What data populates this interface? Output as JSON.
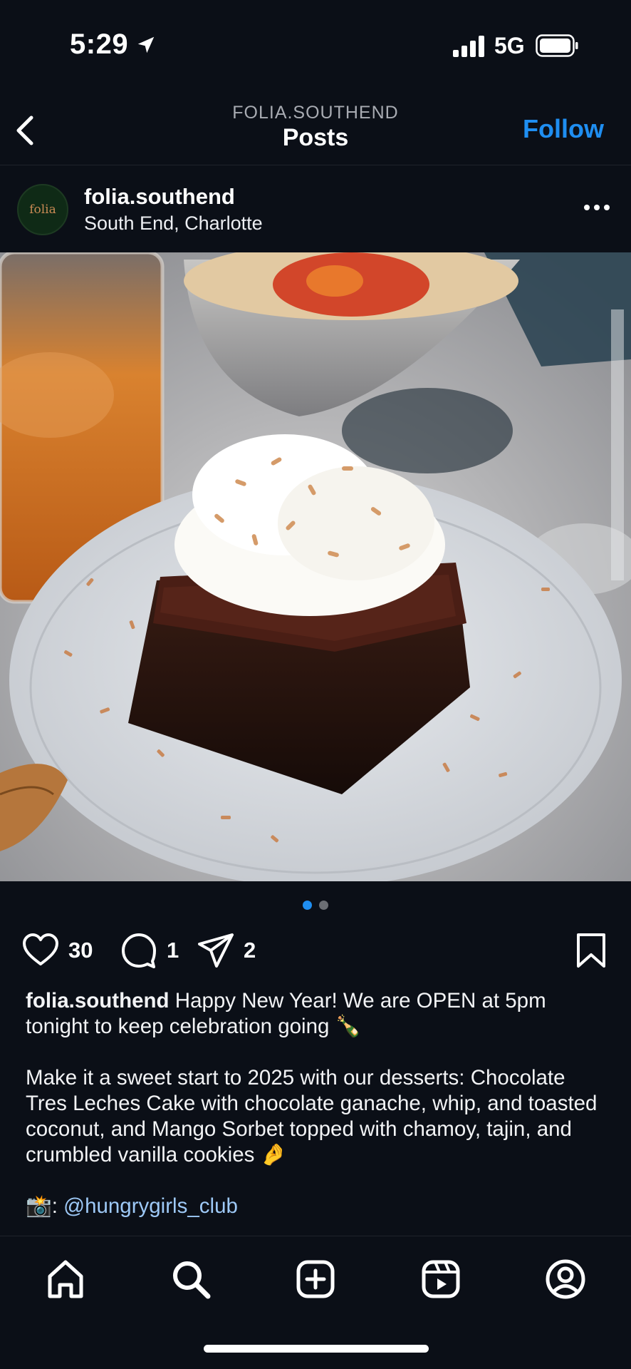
{
  "status_bar": {
    "time": "5:29",
    "network": "5G"
  },
  "header": {
    "account_caption": "FOLIA.SOUTHEND",
    "title": "Posts",
    "follow_label": "Follow"
  },
  "post": {
    "avatar_text": "folia",
    "username": "folia.southend",
    "location": "South End, Charlotte",
    "image_icon": "food-photo",
    "carousel": {
      "current": 1,
      "total": 2
    },
    "likes": "30",
    "comments": "1",
    "shares": "2",
    "caption": {
      "username": "folia.southend",
      "line1": "Happy New Year! We are OPEN at 5pm tonight to keep celebration going 🍾",
      "line2": "Make it a sweet start to 2025 with our desserts: Chocolate Tres Leches Cake with chocolate ganache, whip, and toasted coconut, and Mango Sorbet topped with chamoy, tajin, and crumbled vanilla cookies 🤌",
      "credit_prefix": "📸: ",
      "credit_handle": "@hungrygirls_club"
    }
  },
  "tab_bar": {
    "items": [
      "home-icon",
      "search-icon",
      "create-icon",
      "reels-icon",
      "profile-icon"
    ],
    "active": "search-icon"
  },
  "colors": {
    "background": "#0b0f17",
    "accent": "#1f8ef1",
    "mention": "#9ec9f7"
  }
}
